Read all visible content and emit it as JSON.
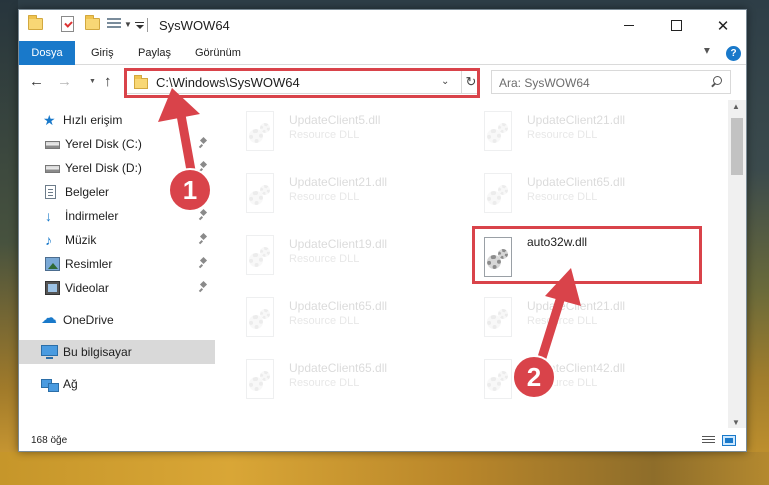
{
  "window": {
    "title": "SysWOW64"
  },
  "ribbon": {
    "tabs": [
      "Dosya",
      "Giriş",
      "Paylaş",
      "Görünüm"
    ]
  },
  "address_bar": {
    "path": "C:\\Windows\\SysWOW64"
  },
  "search": {
    "placeholder": "Ara: SysWOW64"
  },
  "sidebar": {
    "items": [
      {
        "label": "Hızlı erişim",
        "icon": "star-icon"
      },
      {
        "label": "Yerel Disk (C:)",
        "icon": "drive-icon",
        "pinned": true
      },
      {
        "label": "Yerel Disk (D:)",
        "icon": "drive-icon",
        "pinned": true
      },
      {
        "label": "Belgeler",
        "icon": "document-icon",
        "pinned": true
      },
      {
        "label": "İndirmeler",
        "icon": "download-icon",
        "pinned": true
      },
      {
        "label": "Müzik",
        "icon": "music-icon",
        "pinned": true
      },
      {
        "label": "Resimler",
        "icon": "pictures-icon",
        "pinned": true
      },
      {
        "label": "Videolar",
        "icon": "videos-icon",
        "pinned": true
      },
      {
        "label": "OneDrive",
        "icon": "cloud-icon"
      },
      {
        "label": "Bu bilgisayar",
        "icon": "computer-icon",
        "selected": true
      },
      {
        "label": "Ağ",
        "icon": "network-icon"
      }
    ]
  },
  "files": [
    {
      "name": "UpdateClient5.dll",
      "type": "Resource DLL",
      "faded": true
    },
    {
      "name": "UpdateClient21.dll",
      "type": "Resource DLL",
      "faded": true
    },
    {
      "name": "UpdateClient21.dll",
      "type": "Resource DLL",
      "faded": true
    },
    {
      "name": "UpdateClient65.dll",
      "type": "Resource DLL",
      "faded": true
    },
    {
      "name": "UpdateClient19.dll",
      "type": "Resource DLL",
      "faded": true
    },
    {
      "name": "auto32w.dll",
      "type": "",
      "faded": false,
      "highlighted": true
    },
    {
      "name": "UpdateClient65.dll",
      "type": "Resource DLL",
      "faded": true
    },
    {
      "name": "UpdateClient21.dll",
      "type": "Resource DLL",
      "faded": true
    },
    {
      "name": "UpdateClient65.dll",
      "type": "Resource DLL",
      "faded": true
    },
    {
      "name": "UpdateClient42.dll",
      "type": "Resource DLL",
      "faded": true
    }
  ],
  "status": {
    "item_count": "168 öğe"
  },
  "annotations": {
    "step1": "1",
    "step2": "2",
    "color": "#d9434a"
  }
}
